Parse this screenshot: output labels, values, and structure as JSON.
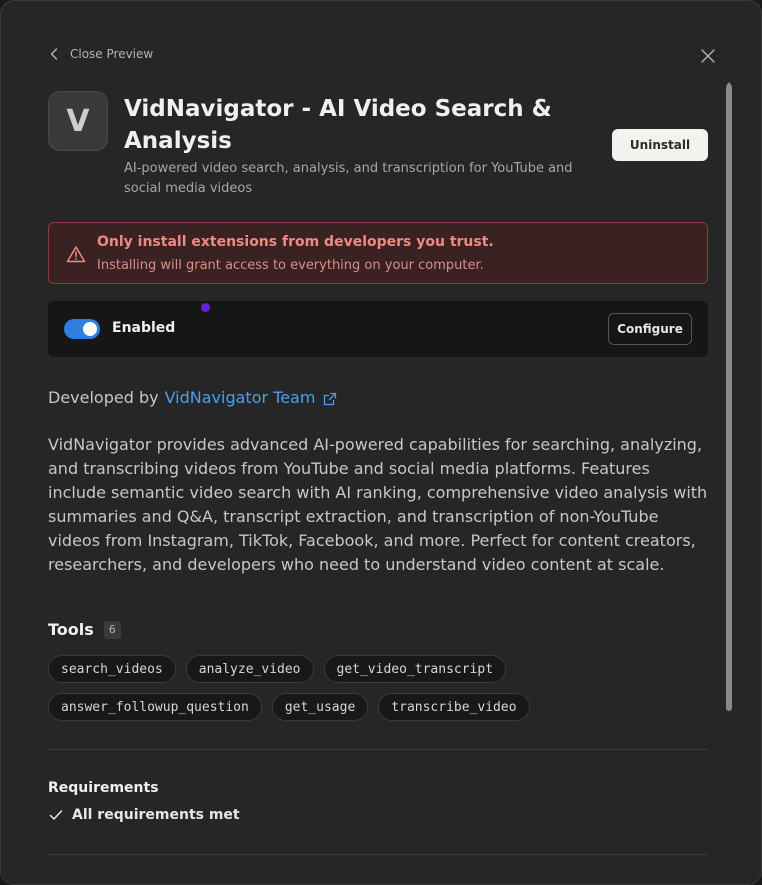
{
  "topbar": {
    "close_preview_label": "Close Preview"
  },
  "header": {
    "icon_letter": "V",
    "title": "VidNavigator - AI Video Search & Analysis",
    "subtitle": "AI-powered video search, analysis, and transcription for YouTube and social media videos",
    "uninstall_label": "Uninstall"
  },
  "warning": {
    "title": "Only install extensions from developers you trust.",
    "text": "Installing will grant access to everything on your computer."
  },
  "status": {
    "enabled_label": "Enabled",
    "configure_label": "Configure",
    "enabled": true
  },
  "developer": {
    "prefix": "Developed by",
    "name": "VidNavigator Team"
  },
  "description": "VidNavigator provides advanced AI-powered capabilities for searching, analyzing, and transcribing videos from YouTube and social media platforms. Features include semantic video search with AI ranking, comprehensive video analysis with summaries and Q&A, transcript extraction, and transcription of non-YouTube videos from Instagram, TikTok, Facebook, and more. Perfect for content creators, researchers, and developers who need to understand video content at scale.",
  "tools": {
    "title": "Tools",
    "count": "6",
    "items": [
      "search_videos",
      "analyze_video",
      "get_video_transcript",
      "answer_followup_question",
      "get_usage",
      "transcribe_video"
    ]
  },
  "requirements": {
    "title": "Requirements",
    "status": "All requirements met"
  },
  "colors": {
    "background": "#262626",
    "accent": "#2e7de0",
    "link": "#4a9ff0",
    "warning_text": "#f08a80",
    "warning_border": "#8a3a3a"
  }
}
